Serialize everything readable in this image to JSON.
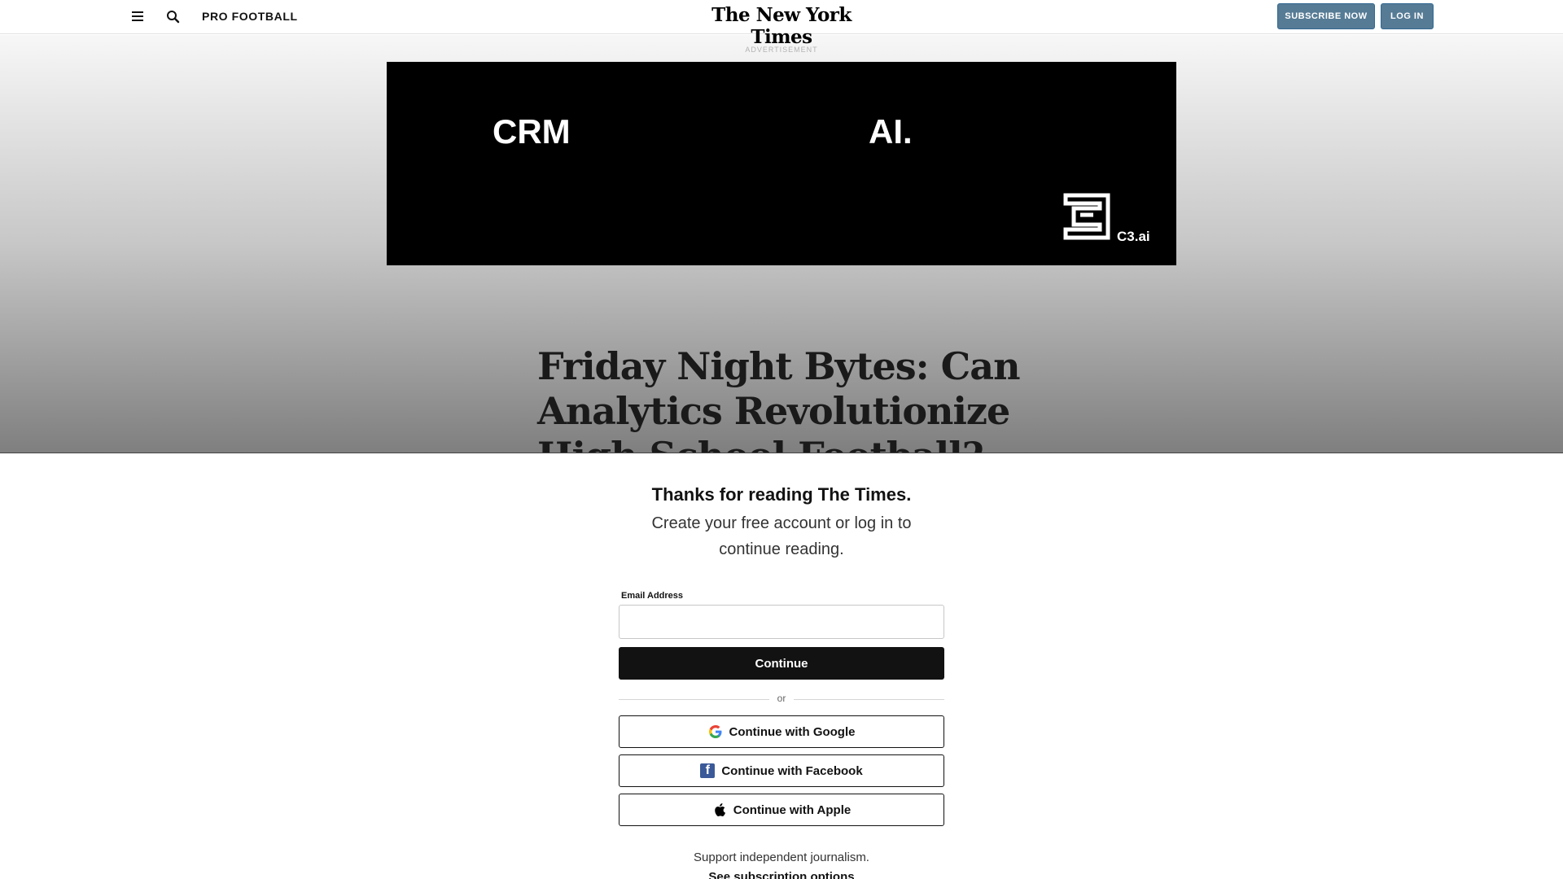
{
  "header": {
    "section": "PRO FOOTBALL",
    "logo": "The New York Times",
    "subscribe_label": "SUBSCRIBE NOW",
    "login_label": "LOG IN",
    "button_color": "#567b95"
  },
  "ad": {
    "label": "ADVERTISEMENT",
    "text_left": "CRM",
    "text_right": "AI.",
    "brand": "C3.ai"
  },
  "article": {
    "headline": "Friday Night Bytes: Can Analytics Revolutionize High School Football?"
  },
  "login_panel": {
    "title": "Thanks for reading The Times.",
    "subtitle": "Create your free account or log in to continue reading.",
    "email_label": "Email Address",
    "email_value": "",
    "continue_label": "Continue",
    "divider_text": "or",
    "google_label": "Continue with Google",
    "facebook_label": "Continue with Facebook",
    "apple_label": "Continue with Apple",
    "support_text": "Support independent journalism.",
    "subscription_link": "See subscription options"
  },
  "icons": [
    "hamburger-menu-icon",
    "search-icon",
    "google-icon",
    "facebook-icon",
    "apple-icon",
    "c3-logo-icon"
  ]
}
